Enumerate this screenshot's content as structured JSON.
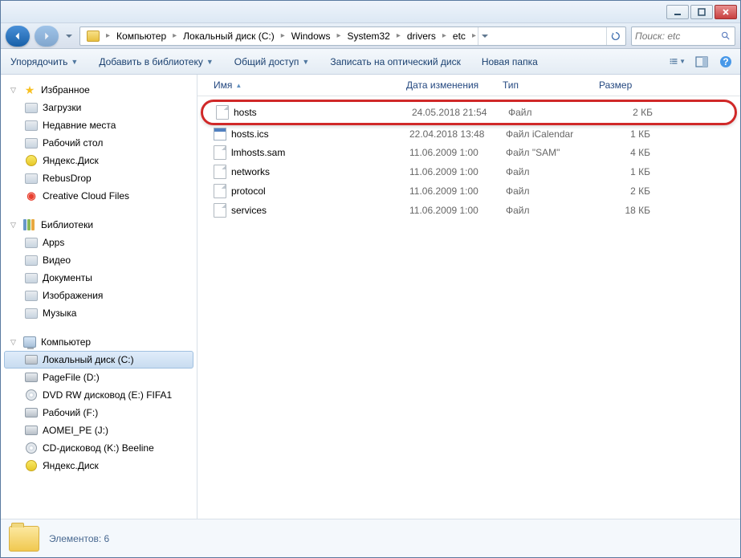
{
  "breadcrumb": [
    "Компьютер",
    "Локальный диск (C:)",
    "Windows",
    "System32",
    "drivers",
    "etc"
  ],
  "search": {
    "placeholder": "Поиск: etc"
  },
  "toolbar": {
    "organize": "Упорядочить",
    "addlib": "Добавить в библиотеку",
    "share": "Общий доступ",
    "burn": "Записать на оптический диск",
    "newfolder": "Новая папка"
  },
  "sidebar": {
    "favorites": {
      "label": "Избранное",
      "items": [
        {
          "label": "Загрузки"
        },
        {
          "label": "Недавние места"
        },
        {
          "label": "Рабочий стол"
        },
        {
          "label": "Яндекс.Диск"
        },
        {
          "label": "RebusDrop"
        },
        {
          "label": "Creative Cloud Files"
        }
      ]
    },
    "libraries": {
      "label": "Библиотеки",
      "items": [
        {
          "label": "Apps"
        },
        {
          "label": "Видео"
        },
        {
          "label": "Документы"
        },
        {
          "label": "Изображения"
        },
        {
          "label": "Музыка"
        }
      ]
    },
    "computer": {
      "label": "Компьютер",
      "items": [
        {
          "label": "Локальный диск (C:)",
          "selected": true
        },
        {
          "label": "PageFile (D:)"
        },
        {
          "label": "DVD RW дисковод (E:) FIFA1"
        },
        {
          "label": "Рабочий (F:)"
        },
        {
          "label": "AOMEI_PE (J:)"
        },
        {
          "label": "CD-дисковод (K:) Beeline"
        },
        {
          "label": "Яндекс.Диск"
        }
      ]
    }
  },
  "columns": {
    "name": "Имя",
    "date": "Дата изменения",
    "type": "Тип",
    "size": "Размер"
  },
  "files": [
    {
      "name": "hosts",
      "date": "24.05.2018 21:54",
      "type": "Файл",
      "size": "2 КБ",
      "highlighted": true
    },
    {
      "name": "hosts.ics",
      "date": "22.04.2018 13:48",
      "type": "Файл iCalendar",
      "size": "1 КБ",
      "cal": true
    },
    {
      "name": "lmhosts.sam",
      "date": "11.06.2009 1:00",
      "type": "Файл \"SAM\"",
      "size": "4 КБ"
    },
    {
      "name": "networks",
      "date": "11.06.2009 1:00",
      "type": "Файл",
      "size": "1 КБ"
    },
    {
      "name": "protocol",
      "date": "11.06.2009 1:00",
      "type": "Файл",
      "size": "2 КБ"
    },
    {
      "name": "services",
      "date": "11.06.2009 1:00",
      "type": "Файл",
      "size": "18 КБ"
    }
  ],
  "status": {
    "text": "Элементов: 6"
  }
}
